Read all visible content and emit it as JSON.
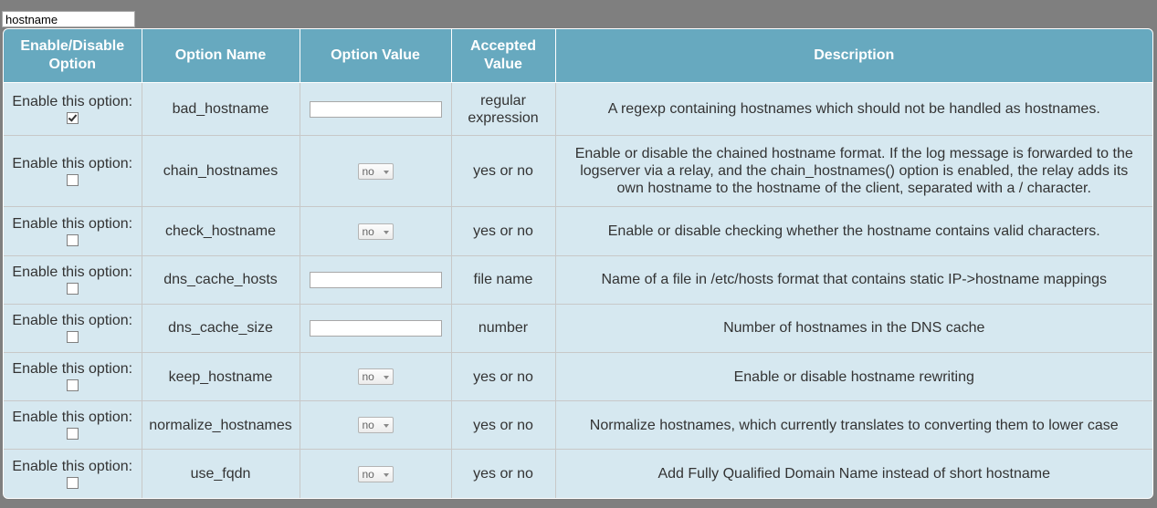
{
  "search": {
    "value": "hostname"
  },
  "headers": {
    "enable": "Enable/Disable Option",
    "name": "Option Name",
    "value": "Option Value",
    "accepted": "Accepted Value",
    "description": "Description"
  },
  "enable_label": "Enable this option:",
  "rows": [
    {
      "enabled": true,
      "name": "bad_hostname",
      "control": "text",
      "value": "",
      "accepted": "regular expression",
      "description": "A regexp containing hostnames which should not be handled as hostnames."
    },
    {
      "enabled": false,
      "name": "chain_hostnames",
      "control": "select",
      "value": "no",
      "accepted": "yes or no",
      "description": "Enable or disable the chained hostname format. If the log message is forwarded to the logserver via a relay, and the chain_hostnames() option is enabled, the relay adds its own hostname to the hostname of the client, separated with a / character."
    },
    {
      "enabled": false,
      "name": "check_hostname",
      "control": "select",
      "value": "no",
      "accepted": "yes or no",
      "description": "Enable or disable checking whether the hostname contains valid characters."
    },
    {
      "enabled": false,
      "name": "dns_cache_hosts",
      "control": "text",
      "value": "",
      "accepted": "file name",
      "description": "Name of a file in /etc/hosts format that contains static IP->hostname mappings"
    },
    {
      "enabled": false,
      "name": "dns_cache_size",
      "control": "text",
      "value": "",
      "accepted": "number",
      "description": "Number of hostnames in the DNS cache"
    },
    {
      "enabled": false,
      "name": "keep_hostname",
      "control": "select",
      "value": "no",
      "accepted": "yes or no",
      "description": "Enable or disable hostname rewriting"
    },
    {
      "enabled": false,
      "name": "normalize_hostnames",
      "control": "select",
      "value": "no",
      "accepted": "yes or no",
      "description": "Normalize hostnames, which currently translates to converting them to lower case"
    },
    {
      "enabled": false,
      "name": "use_fqdn",
      "control": "select",
      "value": "no",
      "accepted": "yes or no",
      "description": "Add Fully Qualified Domain Name instead of short hostname"
    }
  ]
}
